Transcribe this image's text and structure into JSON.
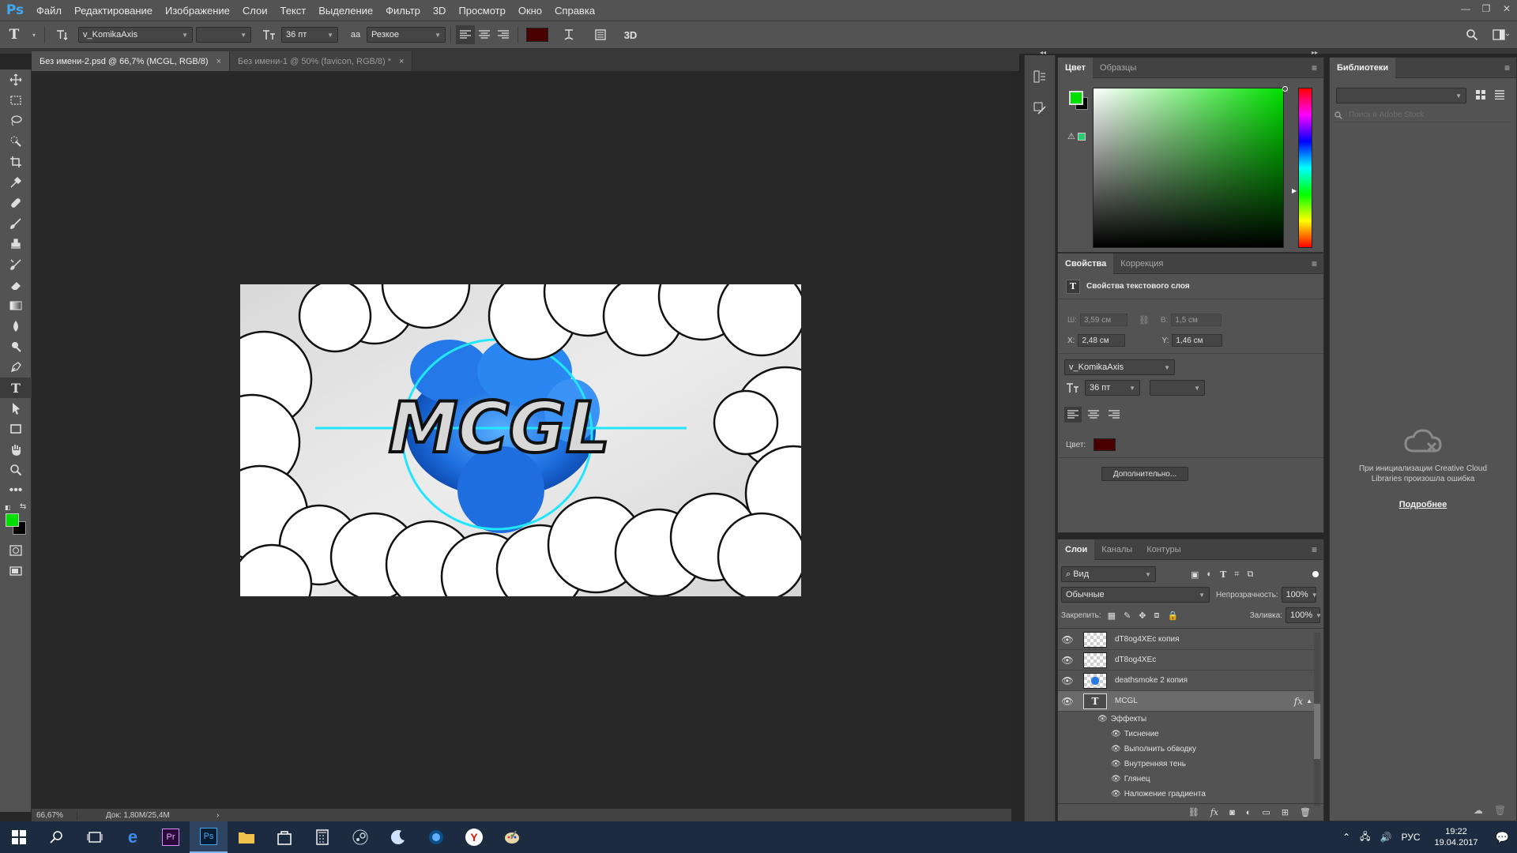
{
  "app": {
    "logo": "Ps"
  },
  "menu": [
    "Файл",
    "Редактирование",
    "Изображение",
    "Слои",
    "Текст",
    "Выделение",
    "Фильтр",
    "3D",
    "Просмотр",
    "Окно",
    "Справка"
  ],
  "window_controls": {
    "minimize": "—",
    "restore": "❐",
    "close": "✕"
  },
  "options_bar": {
    "tool_icon": "T",
    "font_family": "v_KomikaAxis",
    "font_style": "",
    "font_size": "36 пт",
    "aa_icon": "aa",
    "antialias": "Резкое",
    "text_color": "#4a0000",
    "mode_3d": "3D"
  },
  "tabs": [
    {
      "label": "Без имени-2.psd @ 66,7% (MCGL, RGB/8)",
      "close": "×",
      "active": true
    },
    {
      "label": "Без имени-1 @ 50% (favicon, RGB/8) *",
      "close": "×",
      "active": false
    }
  ],
  "canvas": {
    "title_text": "MCGL"
  },
  "status": {
    "zoom": "66,67%",
    "doc": "Док: 1,80M/25,4M",
    "arrow": "›"
  },
  "color_panel": {
    "tabs": [
      "Цвет",
      "Образцы"
    ],
    "foreground": "#00e000",
    "background": "#000000"
  },
  "properties_panel": {
    "tabs": [
      "Свойства",
      "Коррекция"
    ],
    "title": "Свойства текстового слоя",
    "w_label": "Ш:",
    "w_value": "3,59 см",
    "h_label": "В:",
    "h_value": "1,5 см",
    "x_label": "X:",
    "x_value": "2,48 см",
    "y_label": "Y:",
    "y_value": "1,46 см",
    "font_family": "v_KomikaAxis",
    "font_size": "36 пт",
    "color_label": "Цвет:",
    "color_value": "#4a0000",
    "more_button": "Дополнительно..."
  },
  "libraries_panel": {
    "tab": "Библиотеки",
    "search_placeholder": "Поиск в Adobe Stock",
    "error_text": "При инициализации Creative Cloud Libraries произошла ошибка",
    "more_link": "Подробнее"
  },
  "layers_panel": {
    "tabs": [
      "Слои",
      "Каналы",
      "Контуры"
    ],
    "filter_label": "Вид",
    "blend_mode": "Обычные",
    "opacity_label": "Непрозрачность:",
    "opacity_value": "100%",
    "lock_label": "Закрепить:",
    "fill_label": "Заливка:",
    "fill_value": "100%",
    "layers": [
      {
        "name": "dT8og4XEc копия",
        "type": "raster",
        "selected": false
      },
      {
        "name": "dT8og4XEc",
        "type": "raster",
        "selected": false
      },
      {
        "name": "deathsmoke 2 копия",
        "type": "raster",
        "selected": false
      },
      {
        "name": "MCGL",
        "type": "text",
        "selected": true,
        "fx": "fx"
      }
    ],
    "effects_label": "Эффекты",
    "effects": [
      "Тиснение",
      "Выполнить обводку",
      "Внутренняя тень",
      "Глянец",
      "Наложение градиента"
    ]
  },
  "taskbar": {
    "language": "РУС",
    "time": "19:22",
    "date": "19.04.2017"
  }
}
